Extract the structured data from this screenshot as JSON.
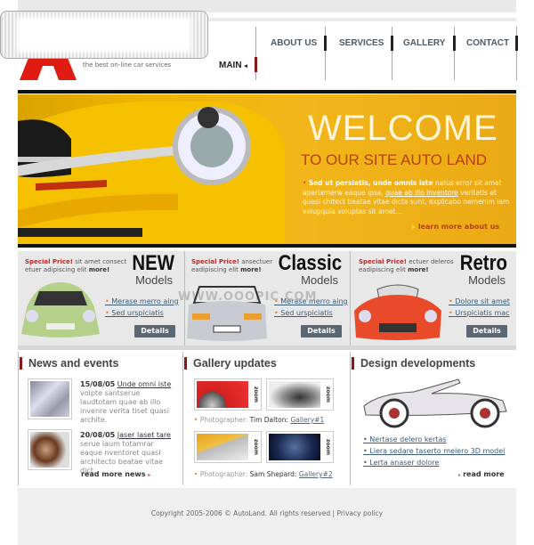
{
  "header": {
    "tagline": "the best on-line car services",
    "nav": [
      {
        "label": "ABOUT US"
      },
      {
        "label": "SERVICES"
      },
      {
        "label": "GALLERY"
      },
      {
        "label": "CONTACT"
      }
    ],
    "current": "MAIN"
  },
  "banner": {
    "title": "WELCOME",
    "subtitle": "TO OUR SITE AUTO LAND",
    "lead": "Sed ut persiatis, unde omnis iste",
    "text1": " natus error sit amet aperiamerw eaque ipsa, ",
    "link": "quae ab illo inventore",
    "text2": " veritatis et quasi chitect beatae vitae dicta sunt, explicabo nemenim iam volupquia voluptas sit amet...",
    "learn_more": "learn more about us"
  },
  "models": [
    {
      "special": "Special Price!",
      "text": " sit amet consect etuer adipiscing elit ",
      "more": "more!",
      "big": "NEW",
      "sub": "Models",
      "links": [
        "Merase merro aing",
        "Sed urspiciatis"
      ],
      "details": "Details",
      "color": "#b5d08a"
    },
    {
      "special": "Special Price!",
      "text": " ansectuer eadipiscing elit ",
      "more": "more!",
      "big": "Classic",
      "sub": "Models",
      "links": [
        "Merase merro aing",
        "Sed urspiciatis"
      ],
      "details": "Details",
      "color": "#c8ccd2"
    },
    {
      "special": "Special Price!",
      "text": " ectuer deleros eadipiscing elit ",
      "more": "more!",
      "big": "Retro",
      "sub": "Models",
      "links": [
        "Dolore sit amet",
        "Urspiciatis mac"
      ],
      "details": "Details",
      "color": "#e84a2a"
    }
  ],
  "watermark": "WWW.OOOPIC.COM",
  "news": {
    "title": "News and events",
    "items": [
      {
        "date": "15/08/05",
        "link": "Unde omni iste",
        "text": "volpte santserue laudtotam quae ab illo invenre verita tiset quasi archite."
      },
      {
        "date": "20/08/05",
        "link": "Jaser laset tare",
        "text": "serue laum totamrar eaque nventoret quasi architecto beatae vitae dict."
      }
    ],
    "more": "read more news"
  },
  "gallery": {
    "title": "Gallery updates",
    "zoom": "zoom",
    "rows": [
      {
        "label": "Photographer:",
        "name": "Tim Dalton:",
        "link": "Gallery#1"
      },
      {
        "label": "Photographer:",
        "name": "Sam Shepard:",
        "link": "Gallery#2"
      }
    ]
  },
  "design": {
    "title": "Design developments",
    "links": [
      "Nertase delero kertas",
      "Liera sedare taserto melero 3D model",
      "Lerta anaser dolore"
    ],
    "more": "read more"
  },
  "footer": {
    "copyright": "Copyright 2005-2006 © AutoLand. All rights reserved",
    "sep": "|",
    "privacy": "Privacy policy"
  },
  "colors": {
    "accent": "#c22222",
    "banner": "#f0b400",
    "nav": "#4a5a66"
  }
}
